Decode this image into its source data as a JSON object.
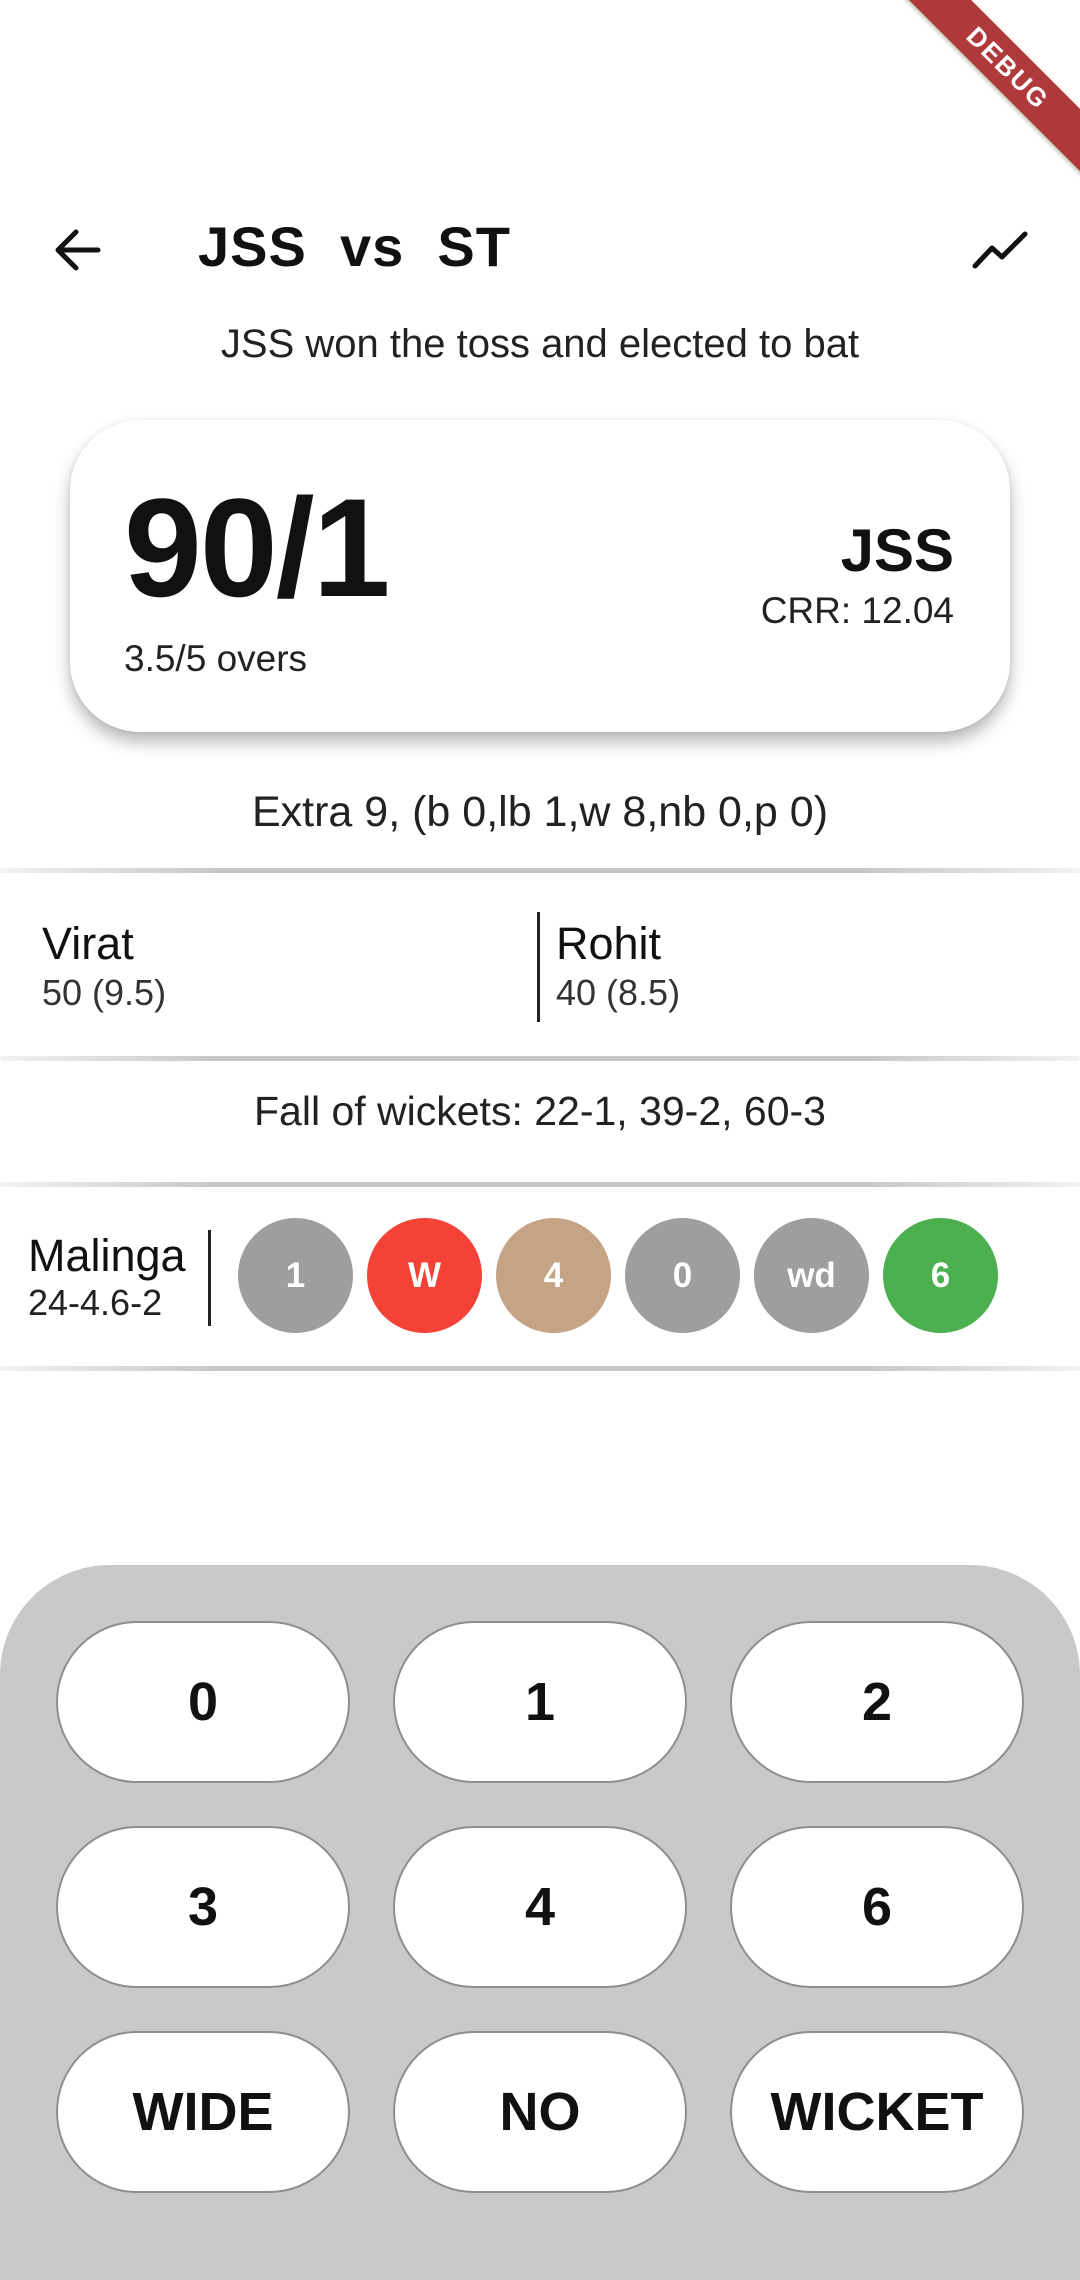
{
  "debug_banner": "DEBUG",
  "header": {
    "title": "JSS  vs  ST",
    "back_icon": "arrow-left-icon",
    "chart_icon": "trending-line-icon"
  },
  "toss_text": "JSS won the toss and elected to bat",
  "scorecard": {
    "score": "90/1",
    "overs": "3.5/5 overs",
    "team": "JSS",
    "crr": "CRR: 12.04"
  },
  "extras_text": "Extra 9, (b 0,lb 1,w 8,nb 0,p 0)",
  "batsmen": [
    {
      "name": "Virat",
      "stat": "50 (9.5)"
    },
    {
      "name": "Rohit",
      "stat": "40 (8.5)"
    }
  ],
  "fall_of_wickets": "Fall of wickets: 22-1, 39-2, 60-3",
  "bowler": {
    "name": "Malinga",
    "stat": "24-4.6-2",
    "balls": [
      {
        "label": "1",
        "color": "#9e9e9e"
      },
      {
        "label": "W",
        "color": "#f44336"
      },
      {
        "label": "4",
        "color": "#c4a484"
      },
      {
        "label": "0",
        "color": "#9e9e9e"
      },
      {
        "label": "wd",
        "color": "#9e9e9e"
      },
      {
        "label": "6",
        "color": "#4caf50"
      }
    ]
  },
  "keypad": {
    "keys": [
      "0",
      "1",
      "2",
      "3",
      "4",
      "6",
      "WIDE",
      "NO",
      "WICKET"
    ]
  }
}
